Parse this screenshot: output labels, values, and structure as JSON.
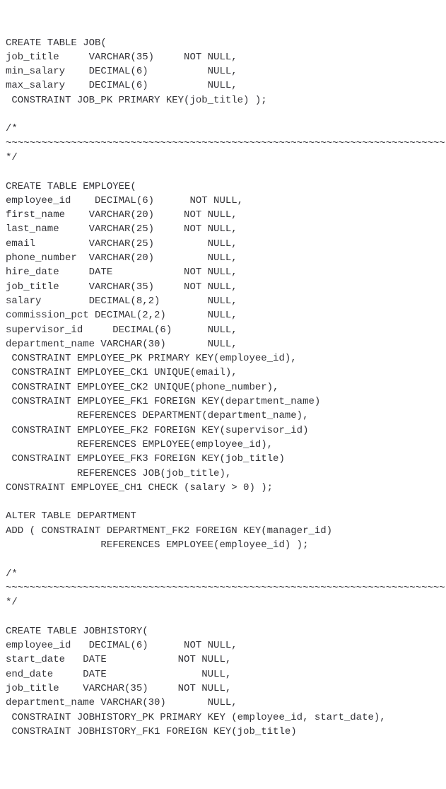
{
  "lines": [
    "CREATE TABLE JOB(",
    "job_title     VARCHAR(35)     NOT NULL,",
    "min_salary    DECIMAL(6)          NULL,",
    "max_salary    DECIMAL(6)          NULL,",
    " CONSTRAINT JOB_PK PRIMARY KEY(job_title) );",
    "",
    "/*",
    "~~~~~~~~~~~~~~~~~~~~~~~~~~~~~~~~~~~~~~~~~~~~~~~~~~~~~~~~~~~~~~~~~~~~~~~~~~",
    "*/",
    "",
    "CREATE TABLE EMPLOYEE(",
    "employee_id    DECIMAL(6)      NOT NULL,",
    "first_name    VARCHAR(20)     NOT NULL,",
    "last_name     VARCHAR(25)     NOT NULL,",
    "email         VARCHAR(25)         NULL,",
    "phone_number  VARCHAR(20)         NULL,",
    "hire_date     DATE            NOT NULL,",
    "job_title     VARCHAR(35)     NOT NULL,",
    "salary        DECIMAL(8,2)        NULL,",
    "commission_pct DECIMAL(2,2)       NULL,",
    "supervisor_id     DECIMAL(6)      NULL,",
    "department_name VARCHAR(30)       NULL,",
    " CONSTRAINT EMPLOYEE_PK PRIMARY KEY(employee_id),",
    " CONSTRAINT EMPLOYEE_CK1 UNIQUE(email),",
    " CONSTRAINT EMPLOYEE_CK2 UNIQUE(phone_number),",
    " CONSTRAINT EMPLOYEE_FK1 FOREIGN KEY(department_name)",
    "            REFERENCES DEPARTMENT(department_name),",
    " CONSTRAINT EMPLOYEE_FK2 FOREIGN KEY(supervisor_id)",
    "            REFERENCES EMPLOYEE(employee_id),",
    " CONSTRAINT EMPLOYEE_FK3 FOREIGN KEY(job_title)",
    "            REFERENCES JOB(job_title),",
    "CONSTRAINT EMPLOYEE_CH1 CHECK (salary > 0) );",
    "",
    "ALTER TABLE DEPARTMENT",
    "ADD ( CONSTRAINT DEPARTMENT_FK2 FOREIGN KEY(manager_id)",
    "                REFERENCES EMPLOYEE(employee_id) );",
    "",
    "/*",
    "~~~~~~~~~~~~~~~~~~~~~~~~~~~~~~~~~~~~~~~~~~~~~~~~~~~~~~~~~~~~~~~~~~~~~~~~~~",
    "*/",
    "",
    "CREATE TABLE JOBHISTORY(",
    "employee_id   DECIMAL(6)      NOT NULL,",
    "start_date   DATE            NOT NULL,",
    "end_date     DATE                NULL,",
    "job_title    VARCHAR(35)     NOT NULL,",
    "department_name VARCHAR(30)       NULL,",
    " CONSTRAINT JOBHISTORY_PK PRIMARY KEY (employee_id, start_date),",
    " CONSTRAINT JOBHISTORY_FK1 FOREIGN KEY(job_title)"
  ]
}
